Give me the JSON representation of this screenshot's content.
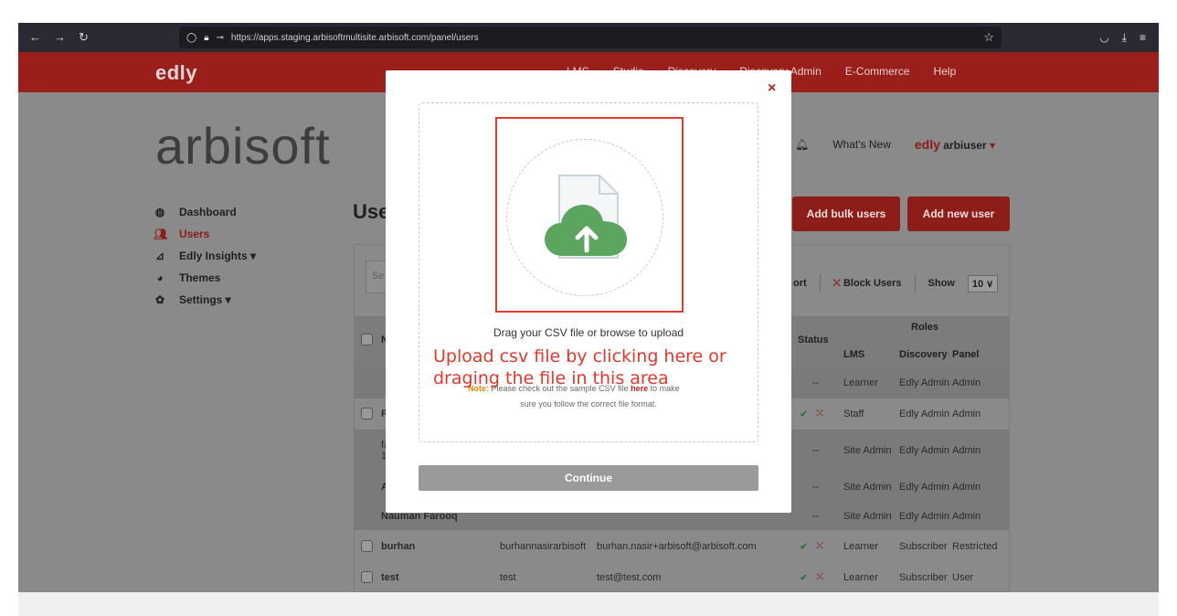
{
  "browser": {
    "url": "https://apps.staging.arbisoftmultisite.arbisoft.com/panel/users"
  },
  "topnav": {
    "logo": "edly",
    "links": [
      "LMS",
      "Studio",
      "Discovery",
      "Discovery Admin",
      "E-Commerce",
      "Help"
    ]
  },
  "header": {
    "brand": "arbisoft",
    "whats_new": "What's New",
    "edly_mini": "edly",
    "username": "arbiuser"
  },
  "sidebar": {
    "items": [
      {
        "label": "Dashboard",
        "icon": "dashboard-icon"
      },
      {
        "label": "Users",
        "icon": "users-icon",
        "active": true
      },
      {
        "label": "Edly Insights ▾",
        "icon": "chart-icon"
      },
      {
        "label": "Themes",
        "icon": "palette-icon"
      },
      {
        "label": "Settings ▾",
        "icon": "gear-icon"
      }
    ]
  },
  "main": {
    "title": "Use",
    "add_bulk_label": "Add bulk users",
    "add_new_label": "Add new user",
    "search_placeholder": "Se",
    "export_label": "ort",
    "block_users_label": "Block Users",
    "show_label": "Show",
    "show_value": "10 ∨"
  },
  "table": {
    "headers": {
      "name": "N",
      "status": "Status",
      "roles": "Roles",
      "lms": "LMS",
      "discovery": "Discovery",
      "panel": "Panel"
    },
    "rows": [
      {
        "name": "",
        "username": "",
        "email": "",
        "status": "--",
        "lms": "Learner",
        "discovery": "Edly Admin",
        "panel": "Admin"
      },
      {
        "name": "R",
        "username": "",
        "email": "",
        "status": "",
        "lms": "Staff",
        "discovery": "Edly Admin",
        "panel": "Admin"
      },
      {
        "name": "fa\n1",
        "username": "",
        "email": "",
        "status": "--",
        "lms": "Site Admin",
        "discovery": "Edly Admin",
        "panel": "Admin"
      },
      {
        "name": "A",
        "username": "",
        "email": "",
        "status": "--",
        "lms": "Site Admin",
        "discovery": "Edly Admin",
        "panel": "Admin"
      },
      {
        "name": "Nauman Farooq",
        "username": "",
        "email": "",
        "status": "--",
        "lms": "Site Admin",
        "discovery": "Edly Admin",
        "panel": "Admin"
      },
      {
        "name": "burhan",
        "username": "burhannasirarbisoft",
        "email": "burhan.nasir+arbisoft@arbisoft.com",
        "status": "",
        "lms": "Learner",
        "discovery": "Subscriber",
        "panel": "Restricted"
      },
      {
        "name": "test",
        "username": "test",
        "email": "test@test.com",
        "status": "",
        "lms": "Learner",
        "discovery": "Subscriber",
        "panel": "User"
      }
    ]
  },
  "modal": {
    "close": "×",
    "drag_text": "Drag your CSV file or browse to upload",
    "annotation_line1": "Upload csv file by clicking here or",
    "annotation_line2": "draging the file in this area",
    "note_label": "Note:",
    "note_text": "Please check out the sample CSV file",
    "note_link": "here",
    "note_text2": "to make",
    "note_line2": "sure you follow the correct file format.",
    "continue_label": "Continue"
  }
}
